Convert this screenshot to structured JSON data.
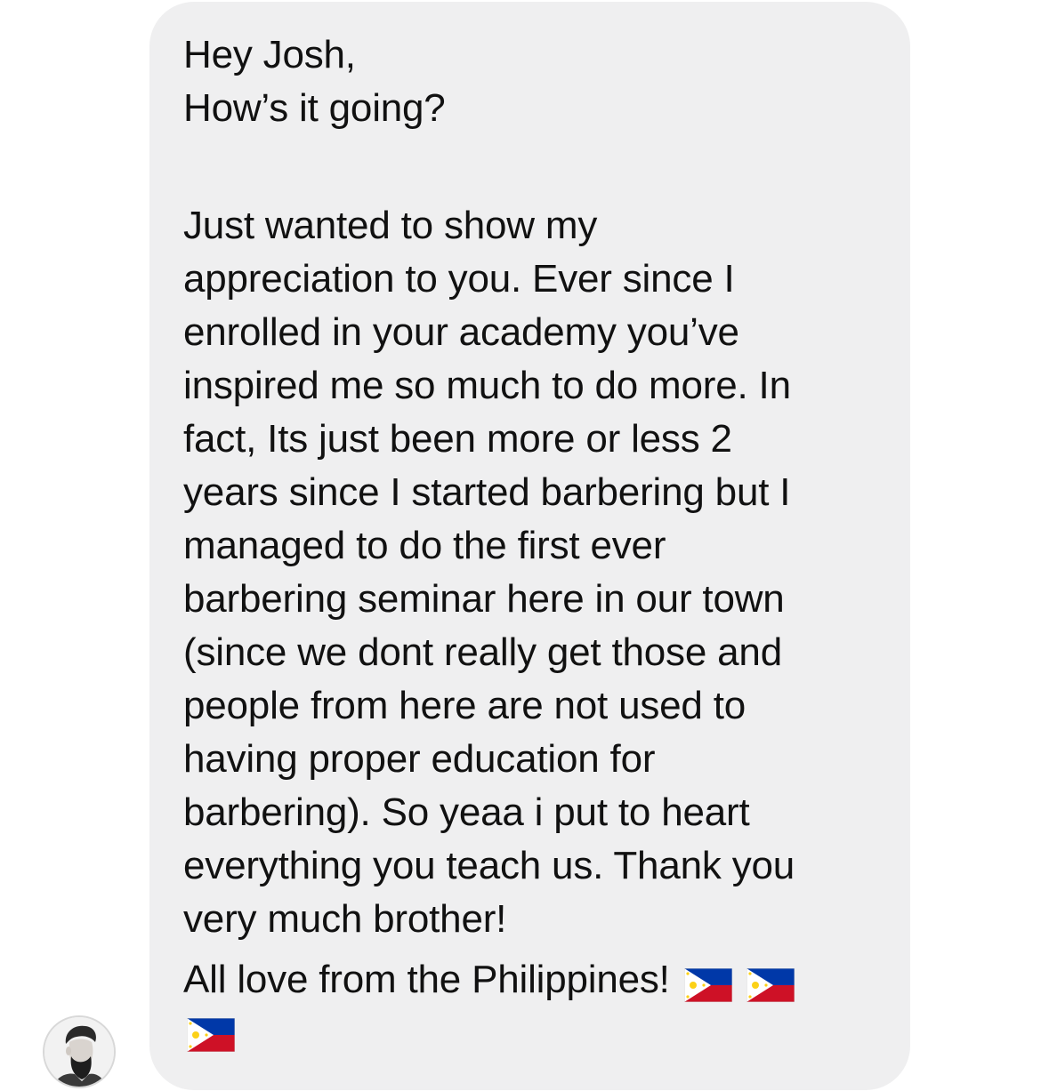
{
  "message": {
    "greeting": "Hey Josh,",
    "question": "How’s it going?",
    "body_lines": [
      "Just wanted to show my",
      "appreciation to you. Ever since I",
      "enrolled in your academy you’ve",
      "inspired me so much to do more. In",
      "fact, Its just been more or less 2",
      "years since I started barbering but I",
      "managed to do the first ever",
      "barbering seminar here in our town",
      "(since we dont really get those and",
      "people from here are not used to",
      "having proper education for",
      "barbering). So yeaa i put to heart",
      "everything you teach us. Thank you",
      "very much brother!"
    ],
    "closing": "All love from the Philippines!",
    "flag_emoji_name": "philippines-flag-icon",
    "flag_count": 3
  },
  "sender": {
    "avatar_icon": "avatar"
  },
  "colors": {
    "bubble_background": "#efeff0",
    "text": "#111111",
    "page_background": "#ffffff"
  }
}
